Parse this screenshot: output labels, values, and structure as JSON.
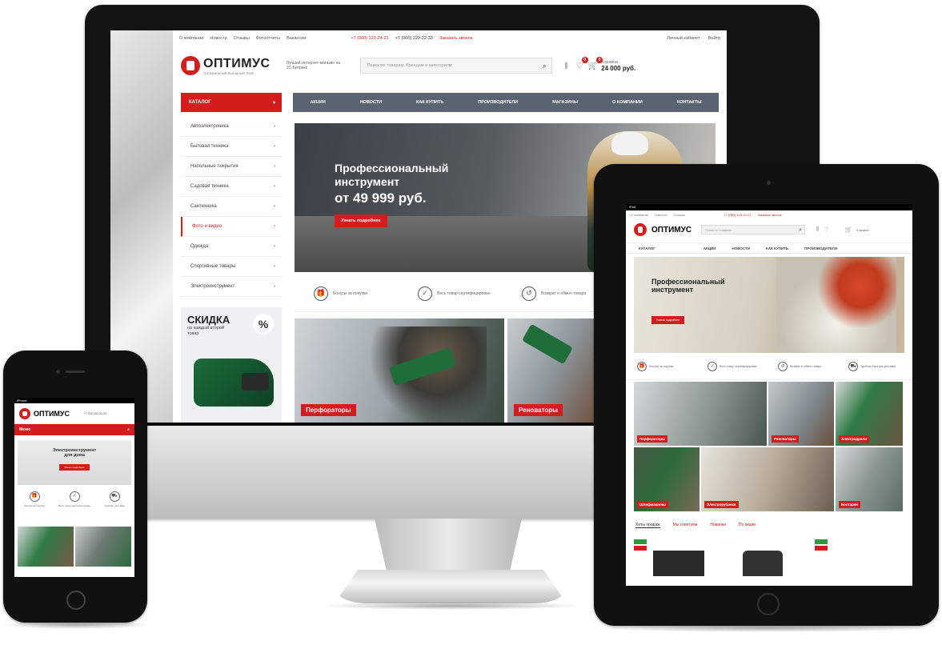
{
  "brand": {
    "name": "ОПТИМУС",
    "subtitle": "Оптимальный Выгодный Твой"
  },
  "desktop": {
    "topbar": {
      "links": [
        "О компании",
        "Новости",
        "Отзывы",
        "Фотоотчеты",
        "Вакансии"
      ],
      "phone1": "+7 (000) 123-24-21",
      "phone2": "+7 (000) 222-22-33",
      "callback": "Заказать звонок",
      "account": "Личный кабинет",
      "login": "Войти"
    },
    "tagline": "Лучший интернет-магазин на 1С-Битрикс",
    "search_placeholder": "Поиск по товарам, брендам и категориям",
    "cart": {
      "label": "Корзина",
      "total": "24 000 руб.",
      "count": "0",
      "fav_count": "0"
    },
    "catalog_label": "КАТАЛОГ",
    "nav": [
      "АКЦИИ",
      "НОВОСТИ",
      "КАК КУПИТЬ",
      "ПРОИЗВОДИТЕЛИ",
      "МАГАЗИНЫ",
      "О КОМПАНИИ",
      "КОНТАКТЫ"
    ],
    "side_menu": [
      "Автоэлектроника",
      "Бытовая техника",
      "Напольные покрытия",
      "Садовая техника",
      "Сантехника",
      "Фото и видео",
      "Одежда",
      "Спортивные товары",
      "Электроинструмент"
    ],
    "side_active_index": 5,
    "promo": {
      "title": "СКИДКА",
      "text": "на каждый второй товар",
      "badge": "%"
    },
    "hero": {
      "line1": "Профессиональный",
      "line2": "инструмент",
      "price": "от 49 999 руб.",
      "button": "Узнать подробнее"
    },
    "features": [
      {
        "icon": "gift-icon",
        "glyph": "🎁",
        "text": "Бонусы за покупки"
      },
      {
        "icon": "check-icon",
        "glyph": "✓",
        "text": "Весь товар сертифицирован"
      },
      {
        "icon": "return-icon",
        "glyph": "↺",
        "text": "Возврат и обмен товара"
      }
    ],
    "tiles": [
      "Перфораторы",
      "Реноваторы"
    ]
  },
  "tablet": {
    "status": "iPad",
    "phone": "+7 (000) 123-24-21",
    "callback": "Заказать звонок",
    "search_placeholder": "Поиск по товарам",
    "nav": [
      "КАТАЛОГ",
      "АКЦИИ",
      "НОВОСТИ",
      "КАК КУПИТЬ",
      "ПРОИЗВОДИТЕЛИ"
    ],
    "hero": {
      "line1": "Профессиональный",
      "line2": "инструмент",
      "button": "Узнать подробнее"
    },
    "features": [
      "Бонусы за покупки",
      "Весь товар сертифицирован",
      "Возврат и обмен товара",
      "Удобная быстрая доставка"
    ],
    "tiles": [
      "Перфораторы",
      "Реноваторы",
      "Электродрели",
      "Шлифмашины",
      "Электрорубанки",
      "Болгарки"
    ],
    "tabs": [
      "Хиты продаж",
      "Мы советуем",
      "Новинки",
      "По акции"
    ]
  },
  "phone": {
    "status": "iPhone",
    "contacts": "+7 000 000-00-00",
    "menu": "Меню",
    "hero": {
      "line1": "Электроинструмент",
      "line2": "для дома",
      "button": "Узнать подробнее"
    },
    "features": [
      "Бонусы за покупки",
      "Весь товар сертифицирован",
      "Удобная доставка"
    ]
  },
  "colors": {
    "accent": "#d41c1c",
    "nav": "#5a6470"
  }
}
